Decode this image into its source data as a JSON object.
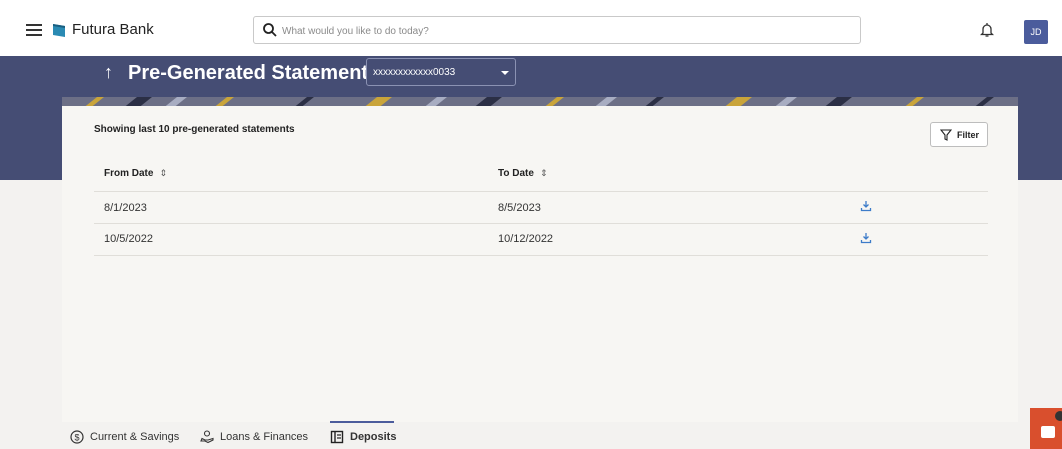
{
  "topbar": {
    "brand": "Futura Bank",
    "search_placeholder": "What would you like to do today?",
    "avatar_initials": "JD"
  },
  "header": {
    "back_arrow": "↑",
    "title": "Pre-Generated Statement",
    "account": "xxxxxxxxxxxx0033"
  },
  "statements": {
    "summary": "Showing last 10 pre-generated statements",
    "filter_label": "Filter",
    "columns": {
      "from": "From Date",
      "to": "To Date",
      "sort_glyph": "⇕"
    },
    "rows": [
      {
        "from": "8/1/2023",
        "to": "8/5/2023"
      },
      {
        "from": "10/5/2022",
        "to": "10/12/2022"
      }
    ]
  },
  "tabs": [
    {
      "label": "Current & Savings",
      "icon": "dollar-circle-icon",
      "active": false
    },
    {
      "label": "Loans & Finances",
      "icon": "loan-hand-icon",
      "active": false
    },
    {
      "label": "Deposits",
      "icon": "deposit-icon",
      "active": true
    }
  ],
  "colors": {
    "header": "#454d74",
    "accent": "#4b5c9c",
    "download": "#3d7cc9",
    "chat": "#d94f2d"
  }
}
